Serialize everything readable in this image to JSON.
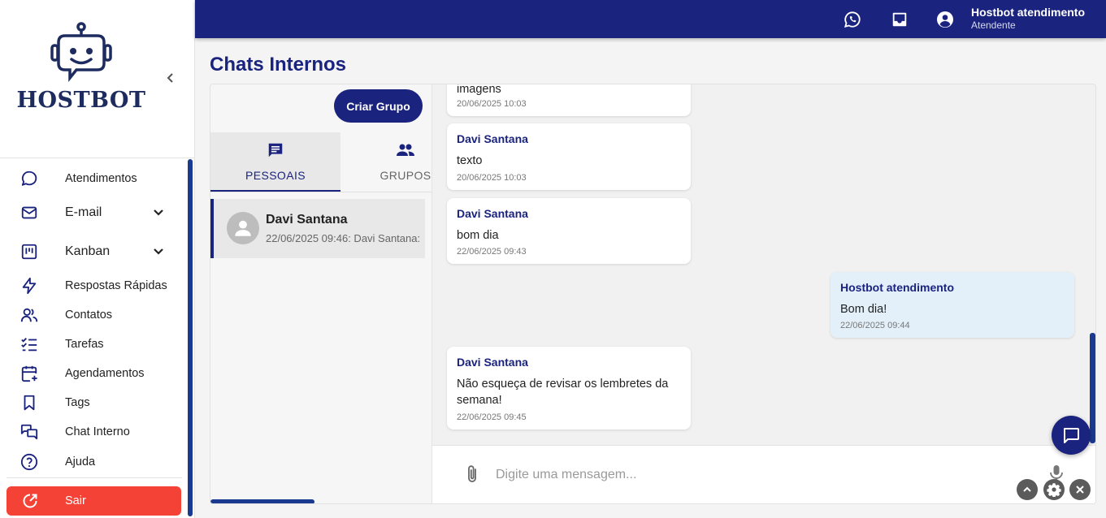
{
  "brand": {
    "logo_text": "HOSTBOT"
  },
  "sidebar": {
    "items": [
      {
        "label": "Atendimentos",
        "icon": "chat-bubble-icon"
      },
      {
        "label": "E-mail",
        "icon": "mail-icon",
        "expandable": true
      },
      {
        "label": "Kanban",
        "icon": "kanban-icon",
        "expandable": true
      },
      {
        "label": "Respostas Rápidas",
        "icon": "lightning-icon"
      },
      {
        "label": "Contatos",
        "icon": "users-icon"
      },
      {
        "label": "Tarefas",
        "icon": "checklist-icon"
      },
      {
        "label": "Agendamentos",
        "icon": "calendar-plus-icon"
      },
      {
        "label": "Tags",
        "icon": "bookmark-icon"
      },
      {
        "label": "Chat Interno",
        "icon": "chat-double-icon"
      },
      {
        "label": "Ajuda",
        "icon": "help-circle-icon"
      }
    ],
    "logout_label": "Sair"
  },
  "topbar": {
    "user_name": "Hostbot atendimento",
    "user_role": "Atendente"
  },
  "page": {
    "title": "Chats Internos"
  },
  "left_panel": {
    "create_group_label": "Criar Grupo",
    "tabs": [
      {
        "label": "PESSOAIS",
        "active": true
      },
      {
        "label": "GRUPOS",
        "active": false
      }
    ],
    "contacts": [
      {
        "name": "Davi Santana",
        "preview": "22/06/2025 09:46: Davi Santana:"
      }
    ]
  },
  "messages": [
    {
      "sender": "",
      "text": "imagens",
      "time": "20/06/2025 10:03",
      "mine": false
    },
    {
      "sender": "Davi Santana",
      "text": "texto",
      "time": "20/06/2025 10:03",
      "mine": false
    },
    {
      "sender": "Davi Santana",
      "text": "bom dia",
      "time": "22/06/2025 09:43",
      "mine": false
    },
    {
      "sender": "Hostbot atendimento",
      "text": "Bom dia!",
      "time": "22/06/2025 09:44",
      "mine": true
    },
    {
      "sender": "Davi Santana",
      "text": "Não esqueça de revisar os lembretes da semana!",
      "time": "22/06/2025 09:45",
      "mine": false
    }
  ],
  "composer": {
    "placeholder": "Digite uma mensagem..."
  },
  "colors": {
    "primary": "#1a237e",
    "logout": "#f44336",
    "own_bubble": "#e3f0f9"
  }
}
